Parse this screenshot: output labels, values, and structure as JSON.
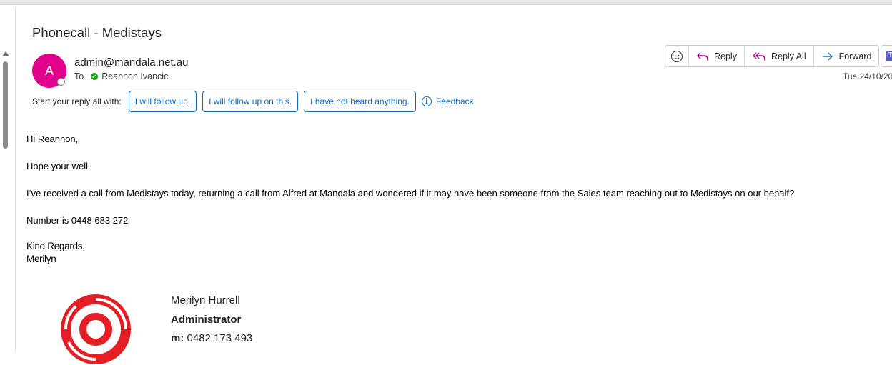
{
  "email": {
    "subject": "Phonecall - Medistays",
    "avatar_initial": "A",
    "from": "admin@mandala.net.au",
    "to_label": "To",
    "to_recipient": "Reannon Ivancic",
    "date": "Tue 24/10/20",
    "actions": {
      "reply": "Reply",
      "reply_all": "Reply All",
      "forward": "Forward"
    },
    "suggested_replies": {
      "label": "Start your reply all with:",
      "options": [
        "I will follow up.",
        "I will follow up on this.",
        "I have not heard anything."
      ],
      "feedback": "Feedback"
    },
    "body": {
      "greeting": "Hi Reannon,",
      "line1": "Hope your well.",
      "line2": "I’ve received a call from Medistays today, returning a call from Alfred at Mandala and wondered if it may have been someone from the Sales team reaching out to Medistays on our behalf?",
      "line3": "Number is 0448 683 272",
      "closing": "Kind Regards,",
      "sender": "Merilyn"
    },
    "signature": {
      "name": "Merilyn Hurrell",
      "title": "Administrator",
      "mobile_label": "m:",
      "mobile": "0482 173 493"
    }
  },
  "colors": {
    "avatar": "#e3008c",
    "accent": "#0f6cbd",
    "logo_red": "#e31e24"
  }
}
